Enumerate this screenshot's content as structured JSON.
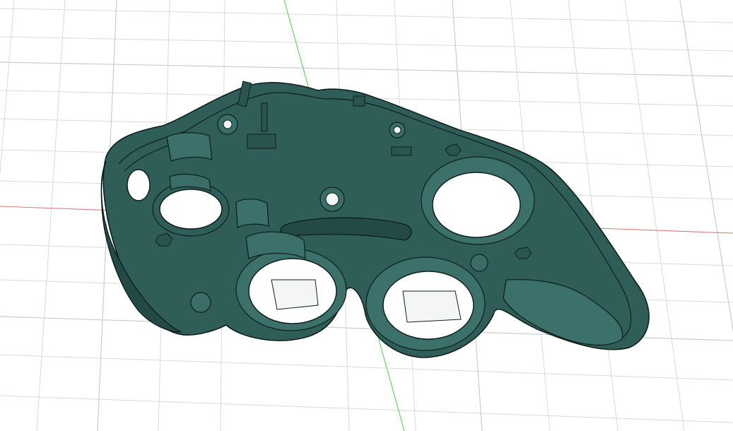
{
  "viewport": {
    "background": "#ffffff",
    "grid_color": "#d7dadd",
    "axis_x_color": "#e07a7a",
    "axis_y_color": "#5fd05f"
  },
  "model": {
    "body_color": "#2f5d58",
    "edge_color": "#0f1f1d"
  }
}
